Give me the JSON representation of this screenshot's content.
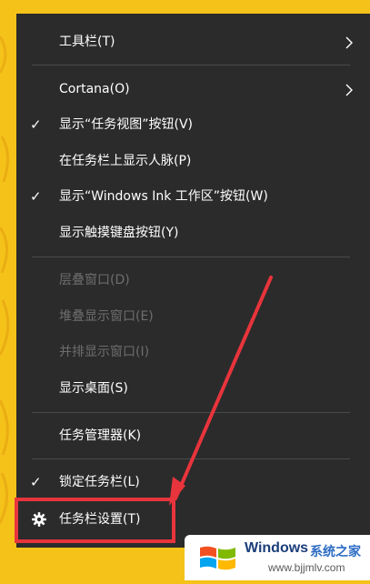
{
  "menu": {
    "items": [
      {
        "label": "工具栏(T)",
        "has_submenu": true
      },
      {
        "label": "Cortana(O)",
        "has_submenu": true
      },
      {
        "label": "显示“任务视图”按钮(V)",
        "checked": true
      },
      {
        "label": "在任务栏上显示人脉(P)"
      },
      {
        "label": "显示“Windows Ink 工作区”按钮(W)",
        "checked": true
      },
      {
        "label": "显示触摸键盘按钮(Y)"
      },
      {
        "label": "层叠窗口(D)",
        "disabled": true
      },
      {
        "label": "堆叠显示窗口(E)",
        "disabled": true
      },
      {
        "label": "并排显示窗口(I)",
        "disabled": true
      },
      {
        "label": "显示桌面(S)"
      },
      {
        "label": "任务管理器(K)"
      },
      {
        "label": "锁定任务栏(L)",
        "checked": true
      },
      {
        "label": "任务栏设置(T)",
        "icon": "gear-icon",
        "highlighted": true
      }
    ],
    "check_glyph": "✓"
  },
  "annotation": {
    "color": "#e8343c"
  },
  "watermark": {
    "title": "Windows",
    "subtitle_cn": "系统之家",
    "url": "www.bjjmlv.com",
    "colors": {
      "red": "#f25022",
      "green": "#7fba00",
      "blue": "#00a4ef",
      "yellow": "#ffb900"
    }
  },
  "colors": {
    "menu_bg": "#2b2b2b",
    "wallpaper": "#f5c219",
    "disabled_text": "#6d6d6d"
  }
}
